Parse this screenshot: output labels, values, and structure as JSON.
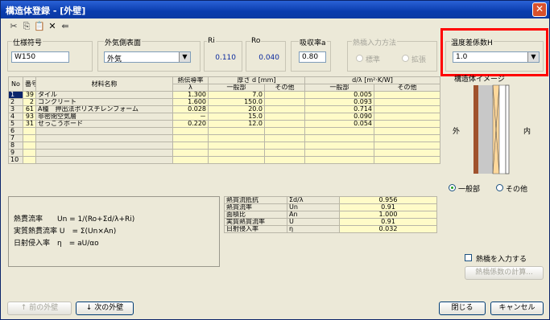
{
  "window": {
    "title": "構造体登録 - [外壁]",
    "close_glyph": "✕"
  },
  "toolbar": {
    "items": [
      "✂",
      "⎘",
      "📋",
      "✕",
      "⇚"
    ]
  },
  "spec": {
    "label": "仕様符号",
    "value": "W150"
  },
  "outer_surface": {
    "label": "外気側表面",
    "value": "外気"
  },
  "ri": {
    "label": "Ri",
    "value": "0.110"
  },
  "ro": {
    "label": "Ro",
    "value": "0.040"
  },
  "absorb": {
    "label": "吸収率a",
    "value": "0.80"
  },
  "heat_bridge_input": {
    "label": "熱橋入力方法",
    "options": [
      "標準",
      "拡張"
    ]
  },
  "temp_diff": {
    "label": "温度差係数H",
    "value": "1.0"
  },
  "table": {
    "headers": {
      "no": "No",
      "num": "番号",
      "material": "材料名称",
      "conductivity": "熱伝導率",
      "lambda": "λ",
      "thickness": "厚さ d [mm]",
      "general": "一般部",
      "other": "その他",
      "d_lambda": "d/λ [m²·K/W]",
      "general2": "一般部",
      "other2": "その他"
    },
    "rows": [
      {
        "no": "1",
        "num": "39",
        "name": "タイル",
        "lambda": "1.300",
        "d": "7.0",
        "d_other": "",
        "dl": "0.005",
        "dl_other": ""
      },
      {
        "no": "2",
        "num": "2",
        "name": "コンクリート",
        "lambda": "1.600",
        "d": "150.0",
        "d_other": "",
        "dl": "0.093",
        "dl_other": ""
      },
      {
        "no": "3",
        "num": "61",
        "name": "A種　押出法ポリスチレンフォーム",
        "lambda": "0.028",
        "d": "20.0",
        "d_other": "",
        "dl": "0.714",
        "dl_other": ""
      },
      {
        "no": "4",
        "num": "93",
        "name": "非密閉空気層",
        "lambda": "－",
        "d": "15.0",
        "d_other": "",
        "dl": "0.090",
        "dl_other": ""
      },
      {
        "no": "5",
        "num": "31",
        "name": "せっこうボード",
        "lambda": "0.220",
        "d": "12.0",
        "d_other": "",
        "dl": "0.054",
        "dl_other": ""
      },
      {
        "no": "6",
        "num": "",
        "name": "",
        "lambda": "",
        "d": "",
        "d_other": "",
        "dl": "",
        "dl_other": ""
      },
      {
        "no": "7",
        "num": "",
        "name": "",
        "lambda": "",
        "d": "",
        "d_other": "",
        "dl": "",
        "dl_other": ""
      },
      {
        "no": "8",
        "num": "",
        "name": "",
        "lambda": "",
        "d": "",
        "d_other": "",
        "dl": "",
        "dl_other": ""
      },
      {
        "no": "9",
        "num": "",
        "name": "",
        "lambda": "",
        "d": "",
        "d_other": "",
        "dl": "",
        "dl_other": ""
      },
      {
        "no": "10",
        "num": "",
        "name": "",
        "lambda": "",
        "d": "",
        "d_other": "",
        "dl": "",
        "dl_other": ""
      }
    ]
  },
  "summary": [
    {
      "label": "熱貫流抵抗",
      "symbol": "Σd/λ",
      "value": "0.956"
    },
    {
      "label": "熱貫流率",
      "symbol": "Un",
      "value": "0.91"
    },
    {
      "label": "面積比",
      "symbol": "An",
      "value": "1.000"
    },
    {
      "label": "実質熱貫流率",
      "symbol": "U",
      "value": "0.91"
    },
    {
      "label": "日射侵入率",
      "symbol": "η",
      "value": "0.032"
    }
  ],
  "formulas": [
    "熱貫流率　　Un = 1/(Ro+Σd/λ+Ri)",
    "実質熱貫流率 U　= Σ(Un×An)",
    "日射侵入率　η　= aU/αo"
  ],
  "image_panel": {
    "label": "構造体イメージ",
    "outside": "外",
    "inside": "内",
    "options": [
      "一般部",
      "その他"
    ]
  },
  "heat_bridge": {
    "checkbox_label": "熱橋を入力する",
    "calc_button": "熱橋係数の計算..."
  },
  "footer": {
    "prev": "↑ 前の外壁",
    "next": "↓ 次の外壁",
    "close": "閉じる",
    "cancel": "キャンセル"
  }
}
